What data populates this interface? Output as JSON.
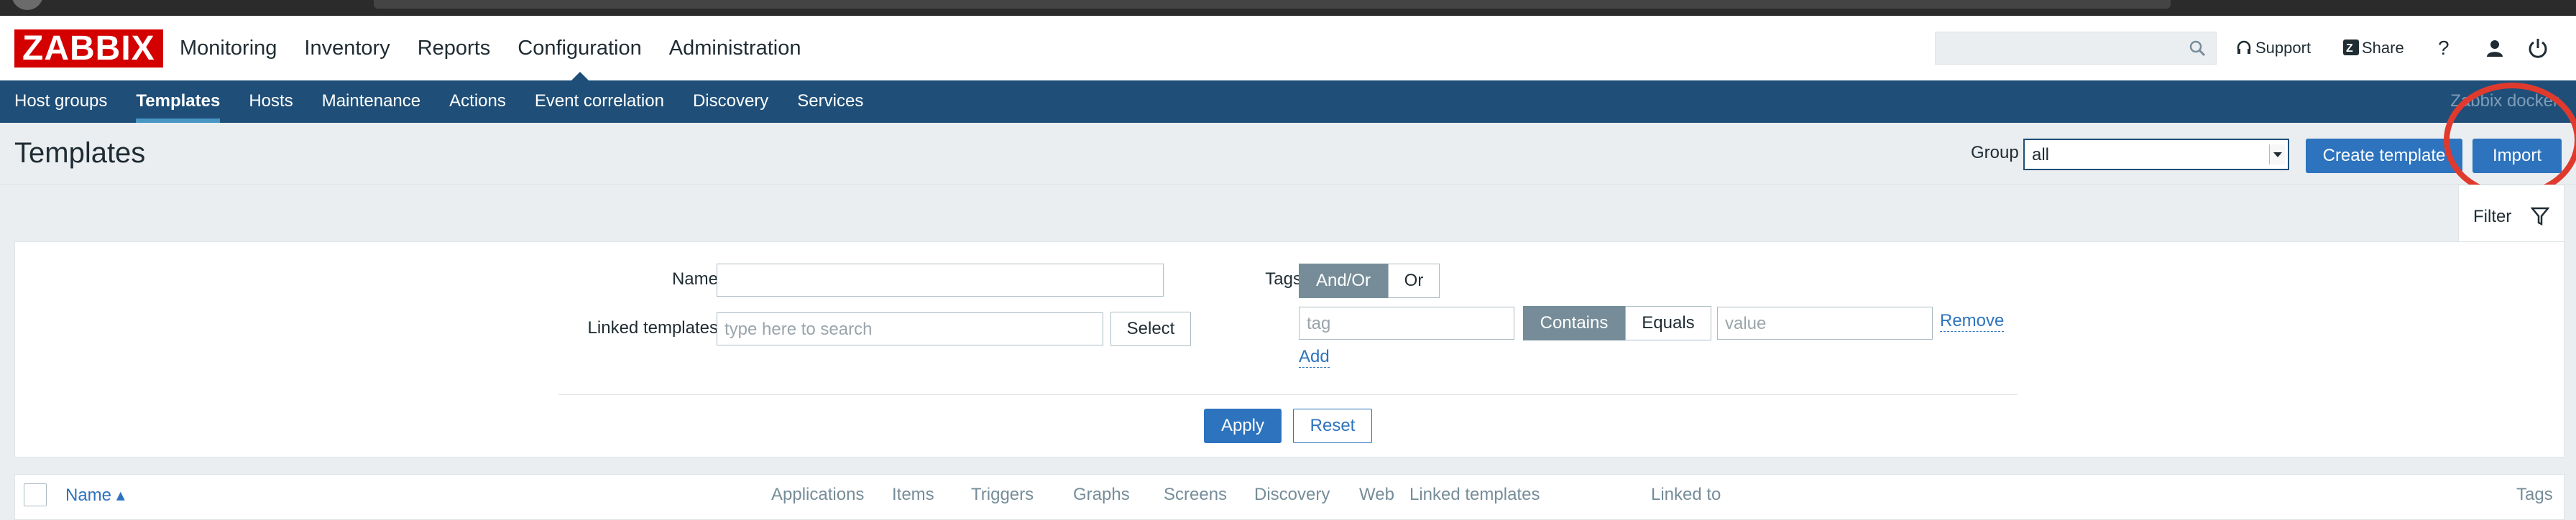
{
  "header": {
    "logo": "ZABBIX",
    "nav": [
      "Monitoring",
      "Inventory",
      "Reports",
      "Configuration",
      "Administration"
    ],
    "active_nav": "Configuration",
    "search_placeholder": "",
    "support_label": "Support",
    "share_label": "Share",
    "help_label": "?"
  },
  "subnav": {
    "items": [
      "Host groups",
      "Templates",
      "Hosts",
      "Maintenance",
      "Actions",
      "Event correlation",
      "Discovery",
      "Services"
    ],
    "active": "Templates",
    "server_name": "Zabbix docker"
  },
  "page": {
    "title": "Templates",
    "group_label": "Group",
    "group_value": "all",
    "create_button": "Create template",
    "import_button": "Import"
  },
  "filter": {
    "tab_label": "Filter",
    "name_label": "Name",
    "name_value": "",
    "linked_label": "Linked templates",
    "linked_placeholder": "type here to search",
    "select_button": "Select",
    "tags_label": "Tags",
    "andor_label": "And/Or",
    "or_label": "Or",
    "tag_placeholder": "tag",
    "contains_label": "Contains",
    "equals_label": "Equals",
    "value_placeholder": "value",
    "remove_label": "Remove",
    "add_label": "Add",
    "apply_button": "Apply",
    "reset_button": "Reset"
  },
  "table": {
    "columns": {
      "name": "Name ▴",
      "applications": "Applications",
      "items": "Items",
      "triggers": "Triggers",
      "graphs": "Graphs",
      "screens": "Screens",
      "discovery": "Discovery",
      "web": "Web",
      "linked_templates": "Linked templates",
      "linked_to": "Linked to",
      "tags": "Tags"
    }
  },
  "colors": {
    "brand_red": "#d40000",
    "subnav_blue": "#1f4f78",
    "button_blue": "#2d73be",
    "annotation_red": "#e03a2e"
  }
}
